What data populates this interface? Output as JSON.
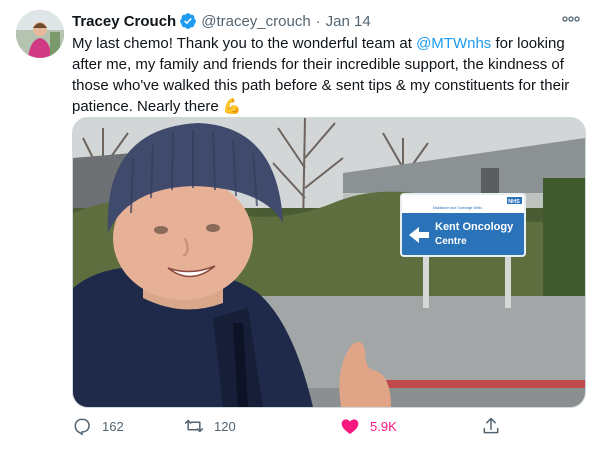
{
  "tweet": {
    "author_name": "Tracey Crouch",
    "handle": "@tracey_crouch",
    "separator": "·",
    "date": "Jan 14",
    "text_part1": "My last chemo! Thank you to the wonderful team at ",
    "mention": "@MTWnhs",
    "text_part2": " for looking after me, my family and friends for their incredible support, the kindness of those who've walked this path before & sent tips & my constituents for their patience. Nearly there ",
    "emoji": "💪"
  },
  "media": {
    "sign_line1": "Kent Oncology",
    "sign_line2": "Centre",
    "sign_header": "Maidstone and Tunbridge Wells",
    "sign_nhs": "NHS"
  },
  "actions": {
    "replies": "162",
    "retweets": "120",
    "likes": "5.9K"
  },
  "icons": {
    "verified": "verified-badge-icon",
    "more": "more-icon",
    "reply": "reply-icon",
    "retweet": "retweet-icon",
    "like": "heart-icon",
    "share": "share-icon"
  },
  "colors": {
    "accent": "#1d9bf0",
    "like": "#f91880",
    "muted": "#536471"
  }
}
